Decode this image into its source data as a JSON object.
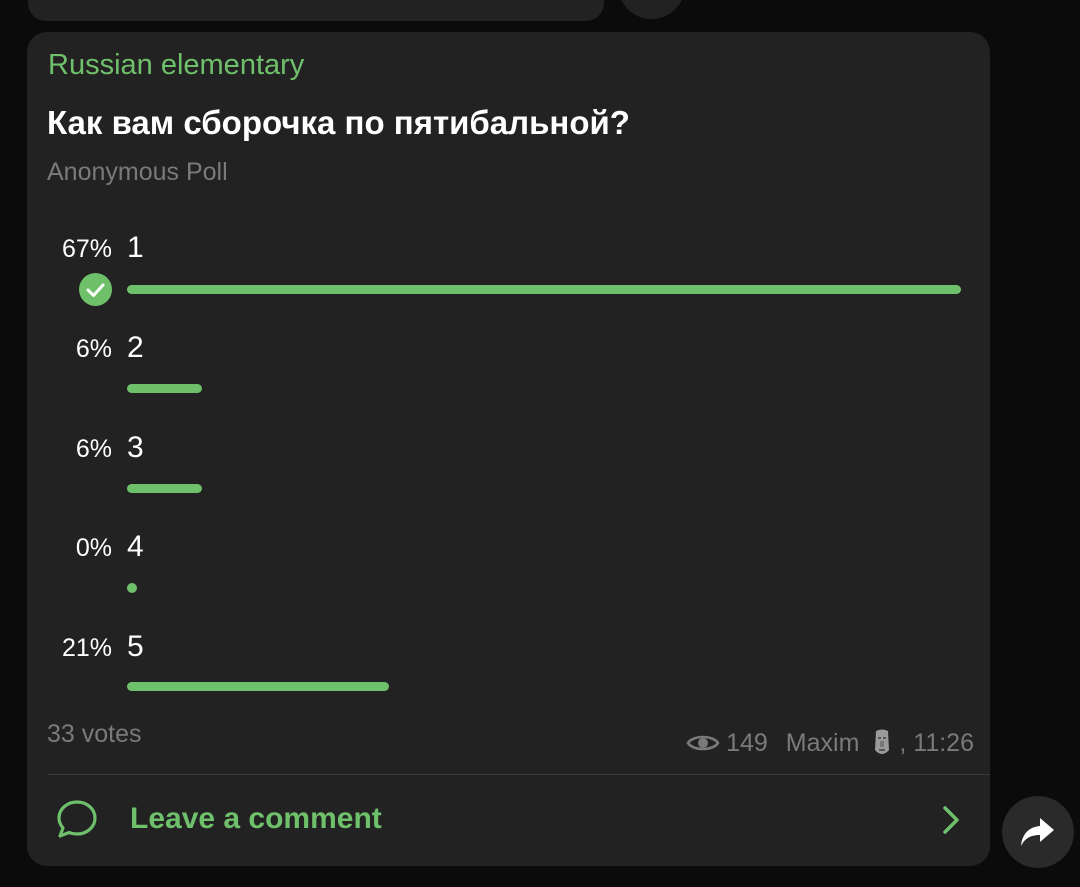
{
  "poll": {
    "channel": "Russian elementary",
    "question": "Как вам сборочка по пятибальной?",
    "type": "Anonymous Poll",
    "options": [
      {
        "label": "1",
        "percent_text": "67%",
        "percent": 67,
        "selected": true
      },
      {
        "label": "2",
        "percent_text": "6%",
        "percent": 6,
        "selected": false
      },
      {
        "label": "3",
        "percent_text": "6%",
        "percent": 6,
        "selected": false
      },
      {
        "label": "4",
        "percent_text": "0%",
        "percent": 0,
        "selected": false
      },
      {
        "label": "5",
        "percent_text": "21%",
        "percent": 21,
        "selected": false
      }
    ],
    "votes": "33 votes",
    "views": "149",
    "author": "Maxim",
    "time": ", 11:26"
  },
  "comment": {
    "label": "Leave a comment"
  },
  "icons": {
    "selected": "checkmark-circle-icon",
    "views": "eye-icon",
    "author_badge": "moai-icon",
    "comment": "speech-bubble-icon",
    "chevron": "chevron-right-icon",
    "share": "share-arrow-icon"
  },
  "colors": {
    "accent": "#6fc06b",
    "bubble": "#222222",
    "background": "#0b0b0b",
    "muted": "#7a7a7a"
  }
}
